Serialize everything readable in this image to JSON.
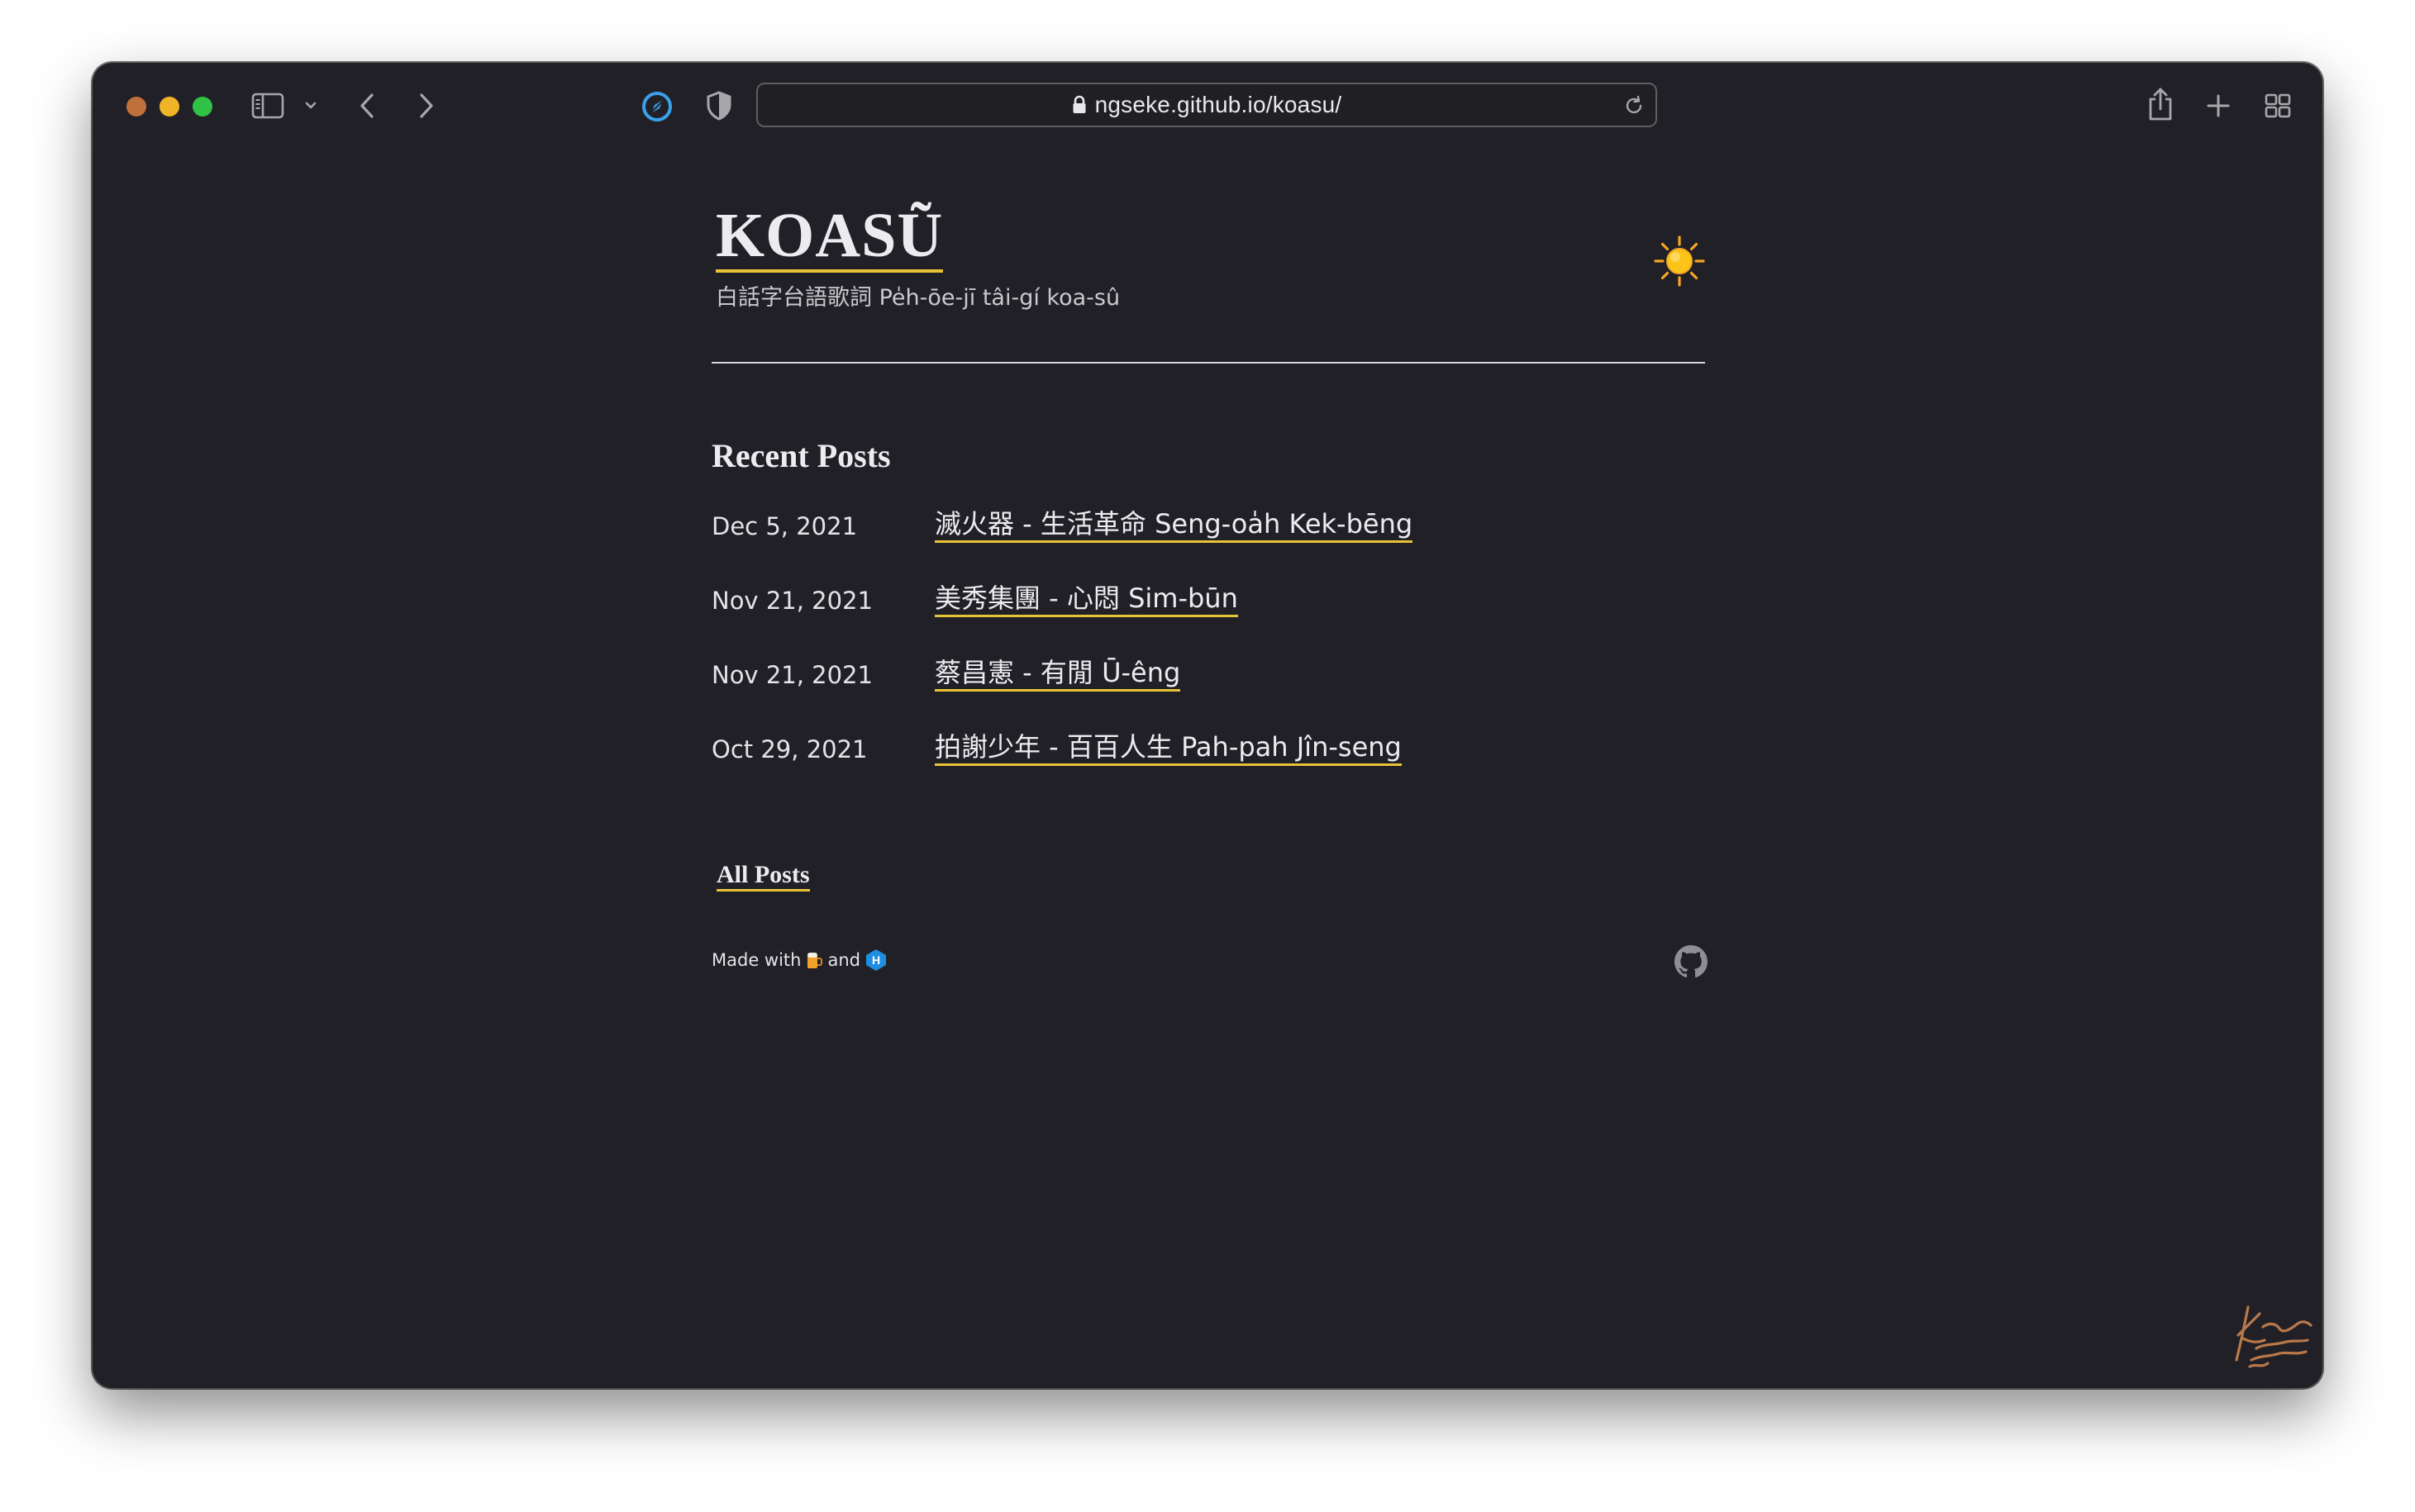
{
  "browser": {
    "url": "ngseke.github.io/koasu/",
    "colors": {
      "close": "#c0703a",
      "minimize": "#f0b429",
      "zoom": "#2fc245"
    },
    "icons": [
      "sidebar-icon",
      "chevron-down-icon",
      "back-icon",
      "forward-icon",
      "compass-icon",
      "shield-icon",
      "lock-icon",
      "reload-icon",
      "share-icon",
      "new-tab-icon",
      "tab-overview-icon"
    ]
  },
  "site": {
    "title": "KOASŨ",
    "subtitle": "白話字台語歌詞 Pe̍h-ōe-jī tâi-gí koa-sû",
    "accent": "#e8c336",
    "theme_icon": "sun-icon"
  },
  "recent": {
    "heading": "Recent Posts",
    "posts": [
      {
        "date": "Dec 5, 2021",
        "title": "滅火器 - 生活革命 Seng-oa̍h Kek-bēng"
      },
      {
        "date": "Nov 21, 2021",
        "title": "美秀集團 - 心悶 Sim-būn"
      },
      {
        "date": "Nov 21, 2021",
        "title": "蔡昌憲 - 有閒 Ū-êng"
      },
      {
        "date": "Oct 29, 2021",
        "title": "拍謝少年 - 百百人生 Pah-pah Jîn-seng"
      }
    ],
    "all_posts": "All Posts"
  },
  "footer": {
    "made_with": "Made with",
    "and": "and",
    "icons": [
      "beer-icon",
      "hugo-icon",
      "github-icon"
    ]
  }
}
